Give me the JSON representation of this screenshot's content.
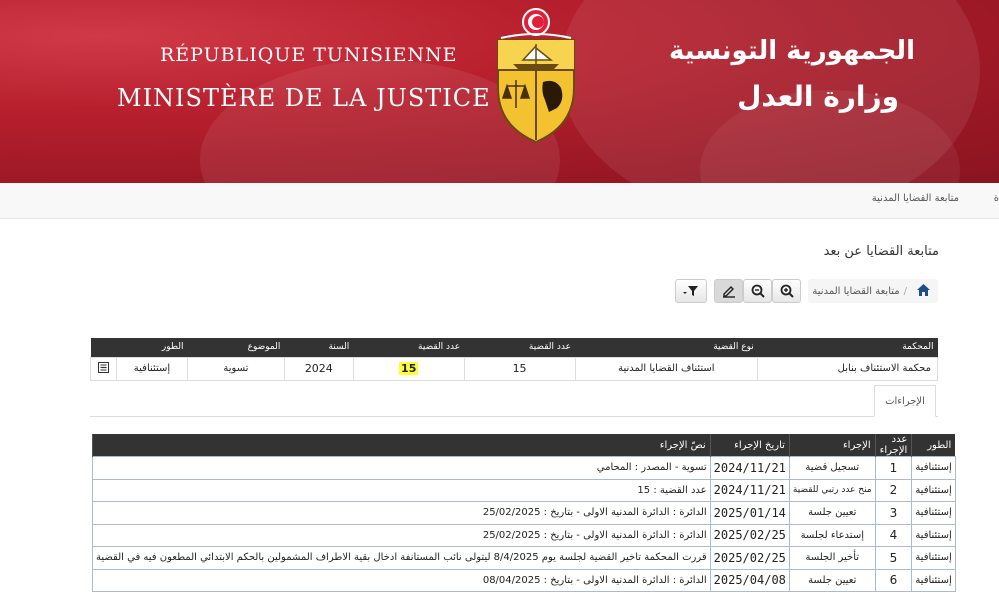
{
  "banner": {
    "fr_line1": "RÉPUBLIQUE TUNISIENNE",
    "fr_line2": "MINISTÈRE DE LA JUSTICE",
    "ar_line1": "الجمهورية التونسية",
    "ar_line2": "وزارة العدل"
  },
  "nav": {
    "link": "متابعة القضايا المدنية",
    "edge": "ة"
  },
  "page_title": "متابعة القضايا عن بعد",
  "breadcrumb": {
    "item": "متابعة القضايا المدنية"
  },
  "case_table": {
    "headers": [
      "المحكمة",
      "نوع القضية",
      "عدد القضية",
      "عدد القضية",
      "السنة",
      "الموضوع",
      "الطور"
    ],
    "row": {
      "court": "محكمة الاستئناف بنابل",
      "type": "استئناف القضايا المدنية",
      "number": "15",
      "number_highlight": "15",
      "year": "2024",
      "subject": "تسوية",
      "stage": "إستئنافية"
    }
  },
  "tabs": {
    "procedures": "الإجراءات"
  },
  "procedures_table": {
    "headers": [
      "الطور",
      "عدد الإجراء",
      "الإجراء",
      "تاريخ الإجراء",
      "نصّ الإجراء"
    ],
    "rows": [
      {
        "stage": "إستئنافية",
        "num": "1",
        "action": "تسجيل قضية",
        "date": "2024/11/21",
        "text": "تسوية - المصدر : المحامي"
      },
      {
        "stage": "إستئنافية",
        "num": "2",
        "action": "منح عدد رتبي للقضية",
        "date": "2024/11/21",
        "text": "عدد القضية : 15"
      },
      {
        "stage": "إستئنافية",
        "num": "3",
        "action": "تعيين جلسة",
        "date": "2025/01/14",
        "text": "الدائرة : الدائرة المدنية الاولى - بتاريخ : 25/02/2025"
      },
      {
        "stage": "إستئنافية",
        "num": "4",
        "action": "إستدعاء لجلسة",
        "date": "2025/02/25",
        "text": "الدائرة : الدائرة المدنية الاولى - بتاريخ : 25/02/2025"
      },
      {
        "stage": "إستئنافية",
        "num": "5",
        "action": "تأخير الجلسة",
        "date": "2025/02/25",
        "text": "قررت المحكمة تاخير القضية لجلسة يوم 8/4/2025 ليتولى نائب المستانفة ادخال بقية الاطراف المشمولين بالحكم الابتدائي المطعون فيه في القضية"
      },
      {
        "stage": "إستئنافية",
        "num": "6",
        "action": "تعيين جلسة",
        "date": "2025/04/08",
        "text": "الدائرة : الدائرة المدنية الاولى - بتاريخ : 08/04/2025"
      }
    ]
  },
  "colors": {
    "banner": "#b8202e",
    "table_header": "#333333",
    "highlight": "#ffff33"
  },
  "icons": [
    "home-icon",
    "zoom-in-icon",
    "zoom-out-icon",
    "edit-icon",
    "filter-icon",
    "collapse-icon"
  ]
}
